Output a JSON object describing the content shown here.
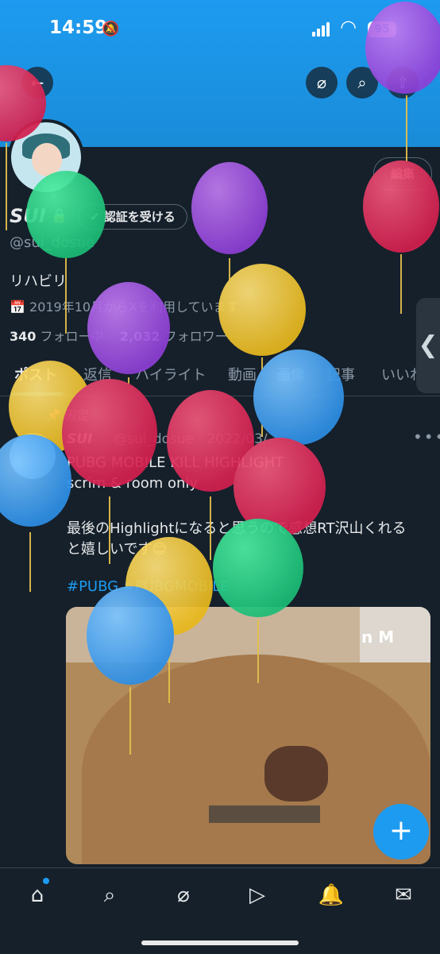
{
  "status_bar": {
    "time": "14:59",
    "battery": "95"
  },
  "header": {
    "back_icon": "←",
    "grok_icon": "⌀",
    "search_icon": "⌕",
    "share_icon": "⇪"
  },
  "profile": {
    "edit_label": "編集",
    "name": "SUI",
    "verify_label": "認証を受ける",
    "handle": "@sui_dosue",
    "bio": "リハビリ",
    "joined": "2019年10月からXを利用しています",
    "following_count": "340",
    "following_label": "フォロー中",
    "followers_count": "2,032",
    "followers_label": "フォロワー"
  },
  "tabs": [
    "ポスト",
    "返信",
    "ハイライト",
    "動画",
    "画像",
    "記事",
    "いいね"
  ],
  "pinned_tweet": {
    "pin_label": "固定",
    "author": "SUI",
    "handle_date": "@sui_dosue · 2022/03/",
    "lines": [
      "PUBG MOBILE KILL HIGHLIGHT",
      "scrim & room only",
      "",
      "最後のHighlightになると思うので感想RT沢山くれる",
      "と嬉しいです😊"
    ],
    "hashtags": "#PUBG #PUBGMOBILE",
    "media_overlay_text": "n M"
  },
  "fab_label": "+",
  "nav": [
    "home-icon",
    "search-icon",
    "grok-icon",
    "video-icon",
    "notifications-icon",
    "messages-icon"
  ],
  "colors": {
    "accent": "#1d9bf0",
    "background": "#15202b",
    "text": "#e7e9ea",
    "muted": "#8b98a5"
  }
}
